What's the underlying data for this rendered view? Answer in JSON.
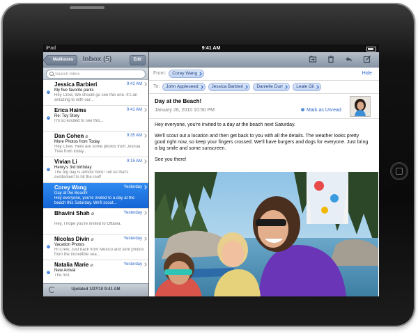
{
  "status_bar": {
    "carrier": "iPad",
    "time": "9:41 AM"
  },
  "mail_list": {
    "back_label": "Mailboxes",
    "title": "Inbox (5)",
    "edit_label": "Edit",
    "search_placeholder": "Search Inbox",
    "messages": [
      {
        "sender": "Jessica Barbieri",
        "time": "9:41 AM",
        "subject": "My five favorite parks",
        "preview": "Hey Crew, We should go see this one. It's an amazing to with our..."
      },
      {
        "sender": "Erica Haims",
        "time": "9:41 AM",
        "subject": "Re: Toy Story",
        "preview": "I'm so excited to see this..."
      },
      {
        "sender": "Dan Cohen",
        "time": "9:35 AM",
        "subject": "More Photos from Today",
        "preview": "Hey Crew, Here are some photos from Joshua Tree from today..."
      },
      {
        "sender": "Vivian Li",
        "time": "9:15 AM",
        "subject": "Henry's 3rd birthday",
        "preview": "The big day is almost here! Tell us that's excitement to hit the roof!"
      },
      {
        "sender": "Corey Wang",
        "time": "Yesterday",
        "subject": "Day at the Beach!",
        "preview": "Hey everyone, you're invited to a day at the beach this Saturday. We'll scout..."
      },
      {
        "sender": "Bhavini Shah",
        "time": "Yesterday",
        "subject": "",
        "preview": "Hey, I hope you're invited to Ottawa."
      },
      {
        "sender": "Nicolas Divin",
        "time": "Yesterday",
        "subject": "Vacation Photos",
        "preview": "Hi Crew, Just back from Mexico and sent photos from the incredible sea..."
      },
      {
        "sender": "Natalia Marie",
        "time": "Yesterday",
        "subject": "New Arrival",
        "preview": "The first"
      }
    ],
    "updated_text": "Updated 1/27/10 9:41 AM"
  },
  "message": {
    "from_label": "From:",
    "from": "Corey Wang",
    "hide_label": "Hide",
    "to_label": "To:",
    "to": [
      "John Appleseed",
      "Jessica Barbieri",
      "Danielle Durr",
      "Leale Gil"
    ],
    "subject": "Day at the Beach!",
    "date": "January 26, 2010 10:50 PM",
    "mark_unread_label": "Mark as Unread",
    "body": [
      "Hey everyone, you're invited to a day at the beach next Saturday.",
      "We'll scout out a location and then get back to you with all the details. The weather looks pretty good right now, so keep your fingers crossed. We'll have burgers and dogs for everyone. Just bring a big smile and some sunscreen.",
      "See you there!"
    ]
  },
  "colors": {
    "accent": "#2a64c8",
    "selected_row": "#1f74e0",
    "bezel": "#0a0a0a"
  }
}
